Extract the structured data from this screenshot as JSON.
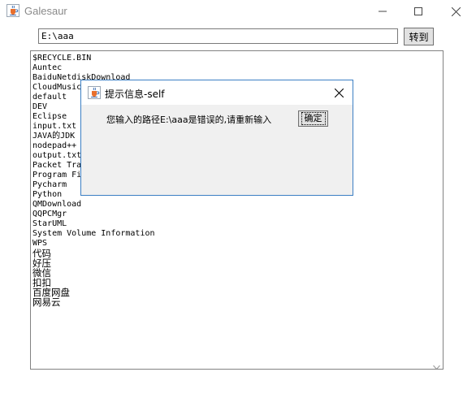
{
  "window": {
    "title": "Galesaur"
  },
  "path_bar": {
    "value": "E:\\aaa",
    "go_label": "转到"
  },
  "file_list": [
    "$RECYCLE.BIN",
    "Auntec",
    "BaiduNetdiskDownload",
    "CloudMusic",
    "default",
    "DEV",
    "Eclipse",
    "input.txt",
    "JAVA的JDK",
    "nodepad++",
    "output.txt",
    "Packet Tracer",
    "Program Files",
    "Pycharm",
    "Python",
    "QMDownload",
    "QQPCMgr",
    "StarUML",
    "System Volume Information",
    "WPS",
    "代码",
    "好压",
    "微信",
    "扣扣",
    "百度网盘",
    "网易云"
  ],
  "dialog": {
    "title": "提示信息-self",
    "message": "您输入的路径E:\\aaa是错误的,请重新输入",
    "ok_label": "确定"
  },
  "icons": {
    "app": "java-cup-icon",
    "minimize": "minimize-icon",
    "maximize": "maximize-icon",
    "close": "close-icon",
    "scroll": "chevron-down-icon"
  }
}
